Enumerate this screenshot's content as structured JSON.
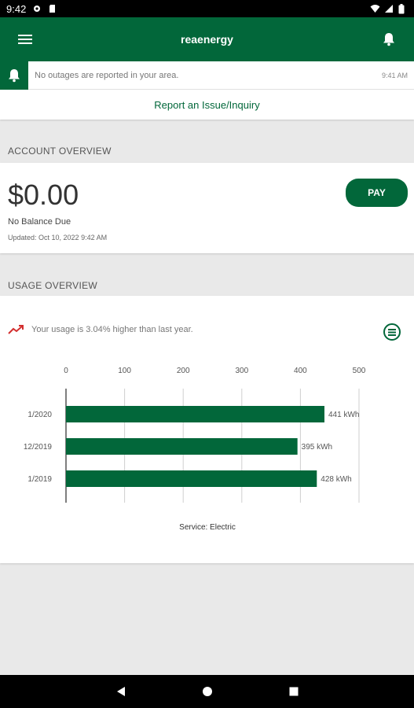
{
  "status_bar": {
    "time": "9:42"
  },
  "app_bar": {
    "title": "reaenergy"
  },
  "outage": {
    "message": "No outages are reported in your area.",
    "time": "9:41 AM"
  },
  "report": {
    "label": "Report an Issue/Inquiry"
  },
  "account": {
    "section_title": "ACCOUNT OVERVIEW",
    "balance": "$0.00",
    "balance_label": "No Balance Due",
    "updated": "Updated: Oct 10, 2022 9:42 AM",
    "pay_label": "PAY"
  },
  "usage": {
    "section_title": "USAGE OVERVIEW",
    "message": "Your usage is 3.04% higher than last year."
  },
  "colors": {
    "brand": "#02673a",
    "trend_up": "#d32f2f"
  },
  "chart_data": {
    "type": "bar",
    "orientation": "horizontal",
    "categories": [
      "1/2020",
      "12/2019",
      "1/2019"
    ],
    "values": [
      441,
      395,
      428
    ],
    "value_labels": [
      "441 kWh",
      "395 kWh",
      "428 kWh"
    ],
    "xlim": [
      0,
      500
    ],
    "ticks": [
      0,
      100,
      200,
      300,
      400,
      500
    ],
    "tick_labels": [
      "0",
      "100",
      "200",
      "300",
      "400",
      "500"
    ],
    "xlabel": "Service: Electric",
    "grid": true,
    "color": "#02673a"
  }
}
